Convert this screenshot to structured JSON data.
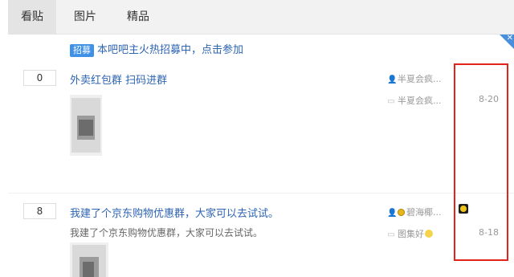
{
  "tabs": [
    {
      "label": "看贴",
      "active": true
    },
    {
      "label": "图片",
      "active": false
    },
    {
      "label": "精品",
      "active": false
    }
  ],
  "promo": {
    "badge": "招募",
    "text": "本吧吧主火热招募中，点击参加"
  },
  "threads": [
    {
      "replies": "0",
      "title": "外卖红包群 扫码进群",
      "excerpt": "",
      "author": "半夏会疯...",
      "last_reply_user": "半夏会疯...",
      "date": "8-20",
      "thumbnail_icon": "blurred-image"
    },
    {
      "replies": "8",
      "title": "我建了个京东购物优惠群，大家可以去试试。",
      "excerpt": "我建了个京东购物优惠群，大家可以去试试。",
      "author": "碧海椰...",
      "last_reply_user": "图集好",
      "date": "8-18",
      "thumbnail_icon": "blurred-image"
    }
  ],
  "icons": {
    "author": "user-icon",
    "reply": "comment-icon",
    "corner": "close-icon",
    "avatar": "sunflower-avatar-icon"
  },
  "colors": {
    "link": "#2d64b3",
    "badge": "#3f91e8",
    "highlight_box": "#e3231a"
  }
}
